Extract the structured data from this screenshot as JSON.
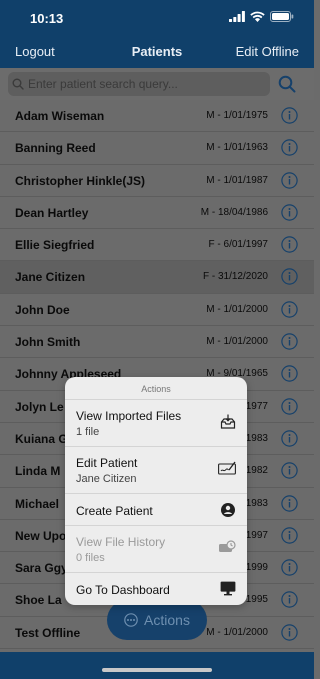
{
  "status_bar": {
    "time": "10:13"
  },
  "nav": {
    "left_label": "Logout",
    "title": "Patients",
    "right_label": "Edit Offline"
  },
  "search": {
    "placeholder": "Enter patient search query..."
  },
  "patients": [
    {
      "name": "Adam Wiseman",
      "meta": "M - 1/01/1975"
    },
    {
      "name": "Banning Reed",
      "meta": "M - 1/01/1963"
    },
    {
      "name": "Christopher Hinkle(JS)",
      "meta": "M - 1/01/1987"
    },
    {
      "name": "Dean Hartley",
      "meta": "M - 18/04/1986"
    },
    {
      "name": "Ellie Siegfried",
      "meta": "F - 6/01/1997"
    },
    {
      "name": "Jane Citizen",
      "meta": "F - 31/12/2020",
      "selected": true
    },
    {
      "name": "John Doe",
      "meta": "M - 1/01/2000"
    },
    {
      "name": "John Smith",
      "meta": "M - 1/01/2000"
    },
    {
      "name": "Johnny Appleseed",
      "meta": "M - 9/01/1965"
    },
    {
      "name": "Jolyn Le",
      "meta": "1977"
    },
    {
      "name": "Kuiana G",
      "meta": "1983"
    },
    {
      "name": "Linda M",
      "meta": "1982"
    },
    {
      "name": "Michael",
      "meta": "1983"
    },
    {
      "name": "New Upo",
      "meta": "1997"
    },
    {
      "name": "Sara Ggy",
      "meta": "1999"
    },
    {
      "name": "Shoe La",
      "meta": "1995"
    },
    {
      "name": "Test Offline",
      "meta": "M - 1/01/2000"
    }
  ],
  "actions_button": {
    "label": "Actions"
  },
  "action_sheet": {
    "title": "Actions",
    "items": [
      {
        "label": "View Imported Files",
        "sub": "1 file",
        "icon": "inbox-download-icon"
      },
      {
        "label": "Edit Patient",
        "sub": "Jane Citizen",
        "icon": "signature-icon"
      },
      {
        "label": "Create Patient",
        "icon": "add-user-icon"
      },
      {
        "label": "View File History",
        "sub": "0 files",
        "icon": "history-icon",
        "disabled": true
      },
      {
        "label": "Go To Dashboard",
        "icon": "monitor-icon"
      }
    ]
  },
  "colors": {
    "nav_background": "#10406a",
    "accent_blue": "#16416b",
    "overlay_gray": "#6b6b6b",
    "sheet_background": "#ededed"
  }
}
